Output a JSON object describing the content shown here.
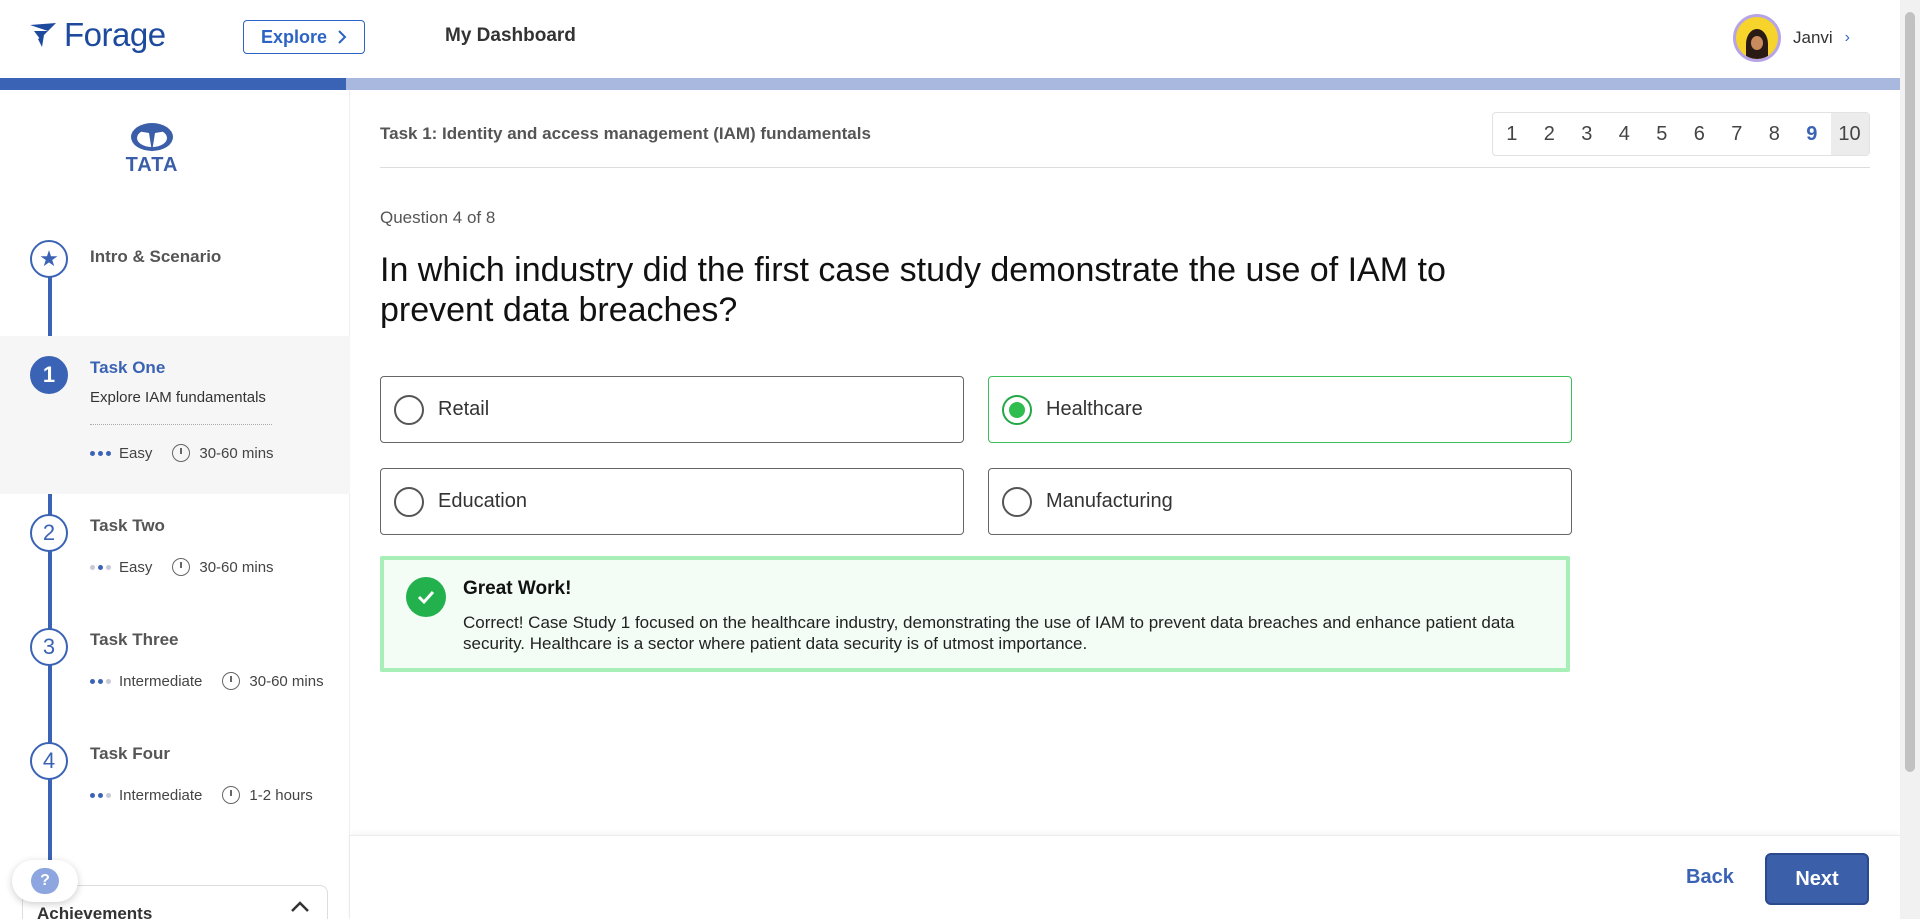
{
  "header": {
    "brand": "Forage",
    "explore_label": "Explore",
    "dashboard_label": "My Dashboard",
    "user_name": "Janvi",
    "user_chevron": "›"
  },
  "progress": {
    "fraction": 0.182,
    "fill_color": "#3b63b5",
    "track_color": "#a8b8de"
  },
  "sidebar": {
    "company_logo_text": "TATA",
    "items": [
      {
        "badge": "★",
        "title": "Intro & Scenario"
      },
      {
        "badge": "1",
        "title": "Task One",
        "subtitle": "Explore IAM fundamentals",
        "level": "Easy",
        "duration": "30-60 mins"
      },
      {
        "badge": "2",
        "title": "Task Two",
        "level": "Easy",
        "duration": "30-60 mins"
      },
      {
        "badge": "3",
        "title": "Task Three",
        "level": "Intermediate",
        "duration": "30-60 mins"
      },
      {
        "badge": "4",
        "title": "Task Four",
        "level": "Intermediate",
        "duration": "1-2 hours"
      }
    ],
    "help_label": "?",
    "achievements_label": "Achievements"
  },
  "main": {
    "task_header": "Task 1: Identity and access management (IAM) fundamentals",
    "pager": [
      "1",
      "2",
      "3",
      "4",
      "5",
      "6",
      "7",
      "8",
      "9",
      "10"
    ],
    "pager_current": "9",
    "question_counter": "Question 4 of 8",
    "question": "In which industry did the first case study demonstrate the use of IAM to prevent data breaches?",
    "options": [
      "Retail",
      "Healthcare",
      "Education",
      "Manufacturing"
    ],
    "selected_option": "Healthcare",
    "feedback": {
      "title": "Great Work!",
      "body": "Correct! Case Study 1 focused on the healthcare industry, demonstrating the use of IAM to prevent data breaches and enhance patient data security. Healthcare is a sector where patient data security is of utmost importance."
    }
  },
  "footer": {
    "back_label": "Back",
    "next_label": "Next"
  },
  "colors": {
    "accent": "#3b63b5",
    "success": "#22b14c",
    "success_border": "#a7efb7"
  }
}
